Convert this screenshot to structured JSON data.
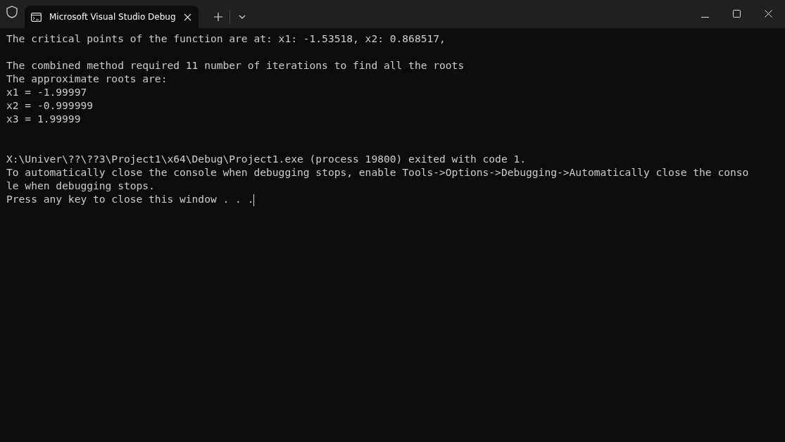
{
  "tab": {
    "title": "Microsoft Visual Studio Debug",
    "selected": true
  },
  "console": {
    "blocks": [
      {
        "kind": "output",
        "lines": [
          "The critical points of the function are at: x1: -1.53518, x2: 0.868517,"
        ]
      },
      {
        "kind": "blank"
      },
      {
        "kind": "output",
        "lines": [
          "The combined method required 11 number of iterations to find all the roots",
          "The approximate roots are:",
          "x1 = -1.99997",
          "x2 = -0.999999",
          "x3 = 1.99999"
        ]
      },
      {
        "kind": "blank"
      },
      {
        "kind": "blank"
      },
      {
        "kind": "output",
        "lines": [
          "X:\\Univer\\??\\??3\\Project1\\x64\\Debug\\Project1.exe (process 19800) exited with code 1.",
          "To automatically close the console when debugging stops, enable Tools->Options->Debugging->Automatically close the conso",
          "le when debugging stops.",
          "Press any key to close this window . . ."
        ]
      }
    ]
  }
}
